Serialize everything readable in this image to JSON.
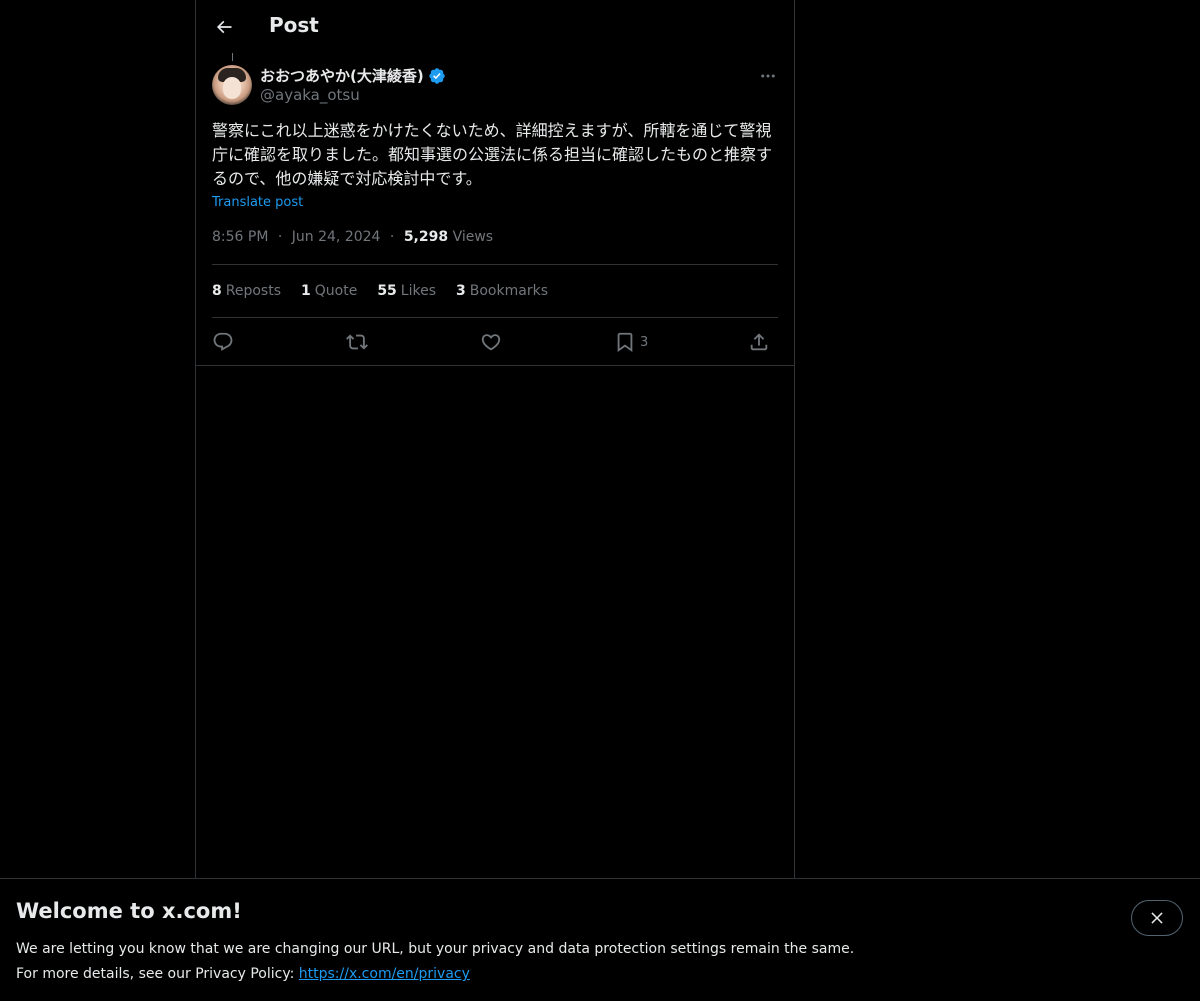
{
  "header": {
    "title": "Post",
    "back_icon": "arrow-left-icon"
  },
  "post": {
    "author": {
      "display_name": "おおつあやか(大津綾香)",
      "handle": "@ayaka_otsu",
      "verified_icon": "verified-badge-icon"
    },
    "more_icon": "more-horizontal-icon",
    "text": "警察にこれ以上迷惑をかけたくないため、詳細控えますが、所轄を通じて警視庁に確認を取りました。都知事選の公選法に係る担当に確認したものと推察するので、他の嫌疑で対応検討中です。",
    "translate_label": "Translate post",
    "time": "8:56 PM",
    "separator": "·",
    "date": "Jun 24, 2024",
    "views_count": "5,298",
    "views_label": "Views"
  },
  "stats": [
    {
      "count": "8",
      "label": "Reposts"
    },
    {
      "count": "1",
      "label": "Quote"
    },
    {
      "count": "55",
      "label": "Likes"
    },
    {
      "count": "3",
      "label": "Bookmarks"
    }
  ],
  "actions": {
    "reply_icon": "reply-icon",
    "repost_icon": "repost-icon",
    "like_icon": "heart-icon",
    "bookmark_icon": "bookmark-icon",
    "bookmark_count": "3",
    "share_icon": "share-icon"
  },
  "banner": {
    "title": "Welcome to x.com!",
    "line1": "We are letting you know that we are changing our URL, but your privacy and data protection settings remain the same.",
    "line2_prefix": "For more details, see our Privacy Policy: ",
    "link_text": "https://x.com/en/privacy",
    "close_icon": "close-icon"
  },
  "colors": {
    "background": "#000000",
    "text": "#e7e9ea",
    "secondary_text": "#71767b",
    "accent": "#1d9bf0",
    "border": "#2f3336"
  }
}
